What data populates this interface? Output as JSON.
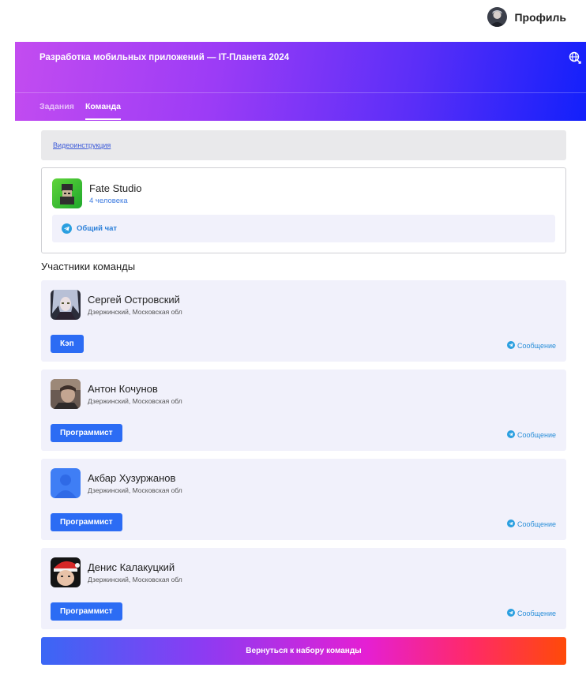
{
  "header": {
    "profile_label": "Профиль",
    "profile_avatar_icon": "profile-avatar"
  },
  "banner": {
    "title": "Разработка мобильных приложений — IT-Планета 2024",
    "globe_icon": "globe-icon",
    "tabs": [
      {
        "label": "Задания",
        "active": false
      },
      {
        "label": "Команда",
        "active": true
      }
    ],
    "gradient": [
      "#c34cf0",
      "#1220fb"
    ]
  },
  "video": {
    "link_label": "Видеоинструкция"
  },
  "team": {
    "name": "Fate Studio",
    "count": "4 человека",
    "chat_label": "Общий чат",
    "logo_icon": "team-logo"
  },
  "members_title": "Участники команды",
  "members": [
    {
      "name": "Сергей Островский",
      "location": "Дзержинский, Московская обл",
      "role": "Кэп",
      "message": "Сообщение",
      "avatar": "anime-avatar"
    },
    {
      "name": "Антон Кочунов",
      "location": "Дзержинский, Московская обл",
      "role": "Программист",
      "message": "Сообщение",
      "avatar": "photo-avatar"
    },
    {
      "name": "Акбар Хузуржанов",
      "location": "Дзержинский, Московская обл",
      "role": "Программист",
      "message": "Сообщение",
      "avatar": "default-user-avatar"
    },
    {
      "name": "Денис Калакуцкий",
      "location": "Дзержинский, Московская обл",
      "role": "Программист",
      "message": "Сообщение",
      "avatar": "santa-hat-avatar"
    }
  ],
  "back_button": "Вернуться к набору команды",
  "colors": {
    "accent": "#2c6cf4",
    "card_bg": "#f1f1fb",
    "link": "#2a8fd9"
  }
}
